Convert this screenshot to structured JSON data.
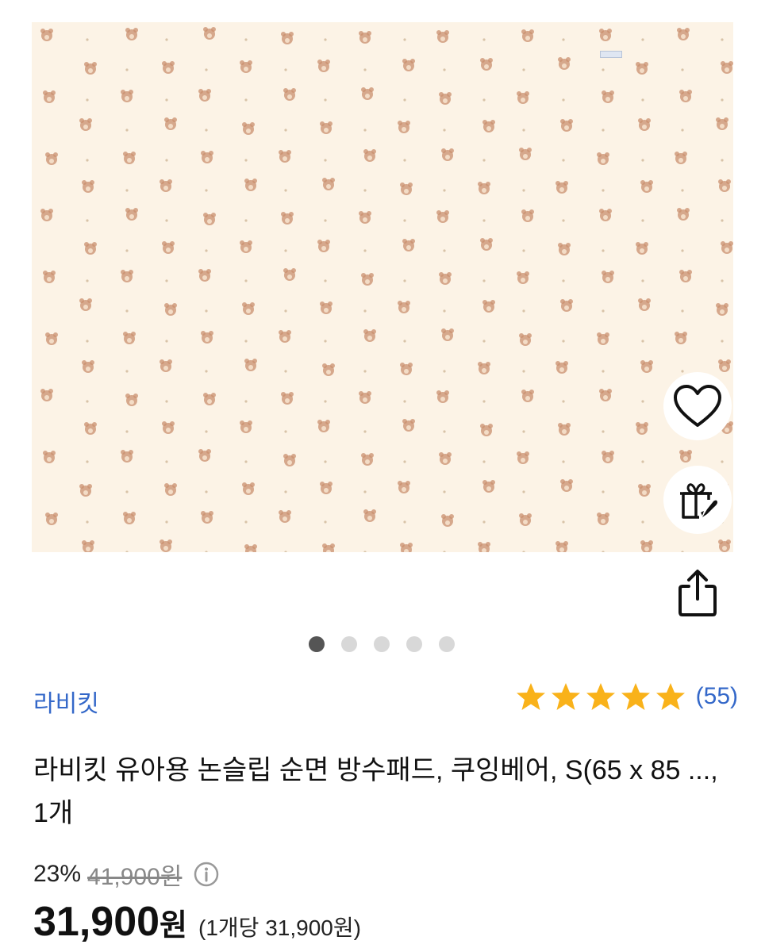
{
  "gallery": {
    "image_count": 5,
    "active_index": 0,
    "background_color": "#fcf3e6",
    "pattern_color": "#c98f6d"
  },
  "actions": {
    "wishlist_icon": "heart-icon",
    "gift_icon": "gift-icon",
    "share_icon": "share-icon"
  },
  "product": {
    "brand": "라비킷",
    "rating": 5,
    "review_count": "(55)",
    "title": "라비킷 유아용 논슬립 순면 방수패드, 쿠잉베어, S(65 x 85 ..., 1개",
    "discount": "23%",
    "original_price": "41,900원",
    "price": "31,900",
    "price_currency": "원",
    "unit_price": "(1개당 31,900원)"
  },
  "colors": {
    "link": "#3468c9",
    "star": "#f9b21a"
  }
}
